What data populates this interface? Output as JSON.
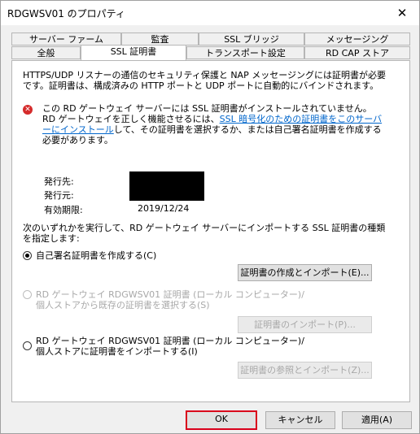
{
  "window": {
    "title": "RDGWSV01 のプロパティ",
    "close_glyph": "✕"
  },
  "tabs": {
    "row1": [
      "サーバー ファーム",
      "監査",
      "SSL ブリッジ",
      "メッセージング"
    ],
    "row2": [
      "全般",
      "SSL 証明書",
      "トランスポート設定",
      "RD CAP ストア"
    ],
    "active": "SSL 証明書"
  },
  "content": {
    "description": "HTTPS/UDP リスナーの通信のセキュリティ保護と NAP メッセージングには証明書が必要です。証明書は、構成済みの HTTP ポートと UDP ポートに自動的にバインドされます。",
    "error_prefix": "この RD ゲートウェイ サーバーには SSL 証明書がインストールされていません。RD ゲートウェイを正しく機能させるには、",
    "error_link": "SSL 暗号化のための証明書をこのサーバーにインストール",
    "error_suffix": "して、その証明書を選択するか、または自己署名証明書を作成する必要があります。",
    "issued_to_label": "発行先:",
    "issued_by_label": "発行元:",
    "expiry_label": "有効期限:",
    "expiry_value": "2019/12/24",
    "instruction": "次のいずれかを実行して、RD ゲートウェイ サーバーにインポートする SSL 証明書の種類を指定します:",
    "option1_label": "自己署名証明書を作成する(C)",
    "option1_button": "証明書の作成とインポート(E)...",
    "option2_label": "RD ゲートウェイ RDGWSV01 証明書 (ローカル コンピューター)/個人ストアから既存の証明書を選択する(S)",
    "option2_button": "証明書のインポート(P)...",
    "option3_label": "RD ゲートウェイ RDGWSV01 証明書 (ローカル コンピューター)/個人ストアに証明書をインポートする(I)",
    "option3_button": "証明書の参照とインポート(Z)..."
  },
  "footer": {
    "ok": "OK",
    "cancel": "キャンセル",
    "apply": "適用(A)"
  },
  "colors": {
    "error": "#d52b2b",
    "link": "#0066cc",
    "ok_highlight": "#d9001b"
  }
}
